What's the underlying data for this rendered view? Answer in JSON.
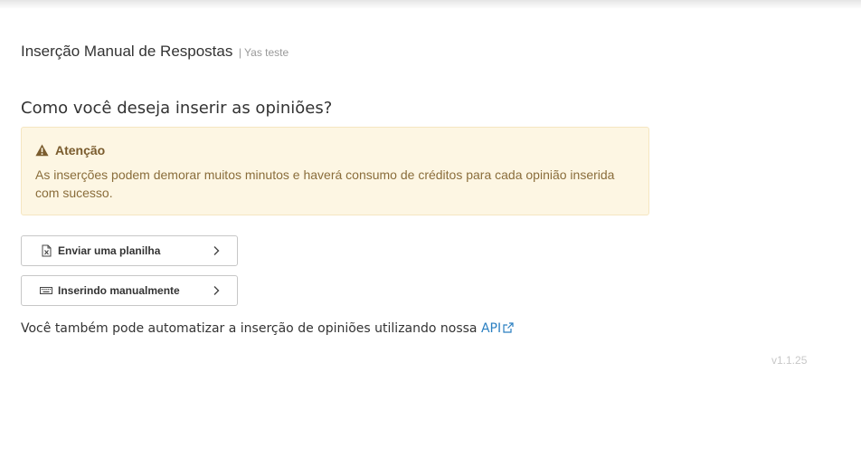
{
  "header": {
    "title": "Inserção Manual de Respostas",
    "subtitle": "| Yas teste"
  },
  "question": "Como você deseja inserir as opiniões?",
  "alert": {
    "icon": "warning-triangle-icon",
    "title": "Atenção",
    "text": "As inserções podem demorar muitos minutos e haverá consumo de créditos para cada opinião inserida com sucesso.",
    "color": "#8a6d3b",
    "background": "#fdf6e3"
  },
  "options": [
    {
      "label": "Enviar uma planilha",
      "icon": "spreadsheet-icon"
    },
    {
      "label": "Inserindo manualmente",
      "icon": "keyboard-icon"
    }
  ],
  "api_note": {
    "text": "Você também pode automatizar a inserção de opiniões utilizando nossa ",
    "link_label": "API",
    "link_icon": "external-link-icon",
    "link_color": "#2a7fc1"
  },
  "version": "v1.1.25"
}
